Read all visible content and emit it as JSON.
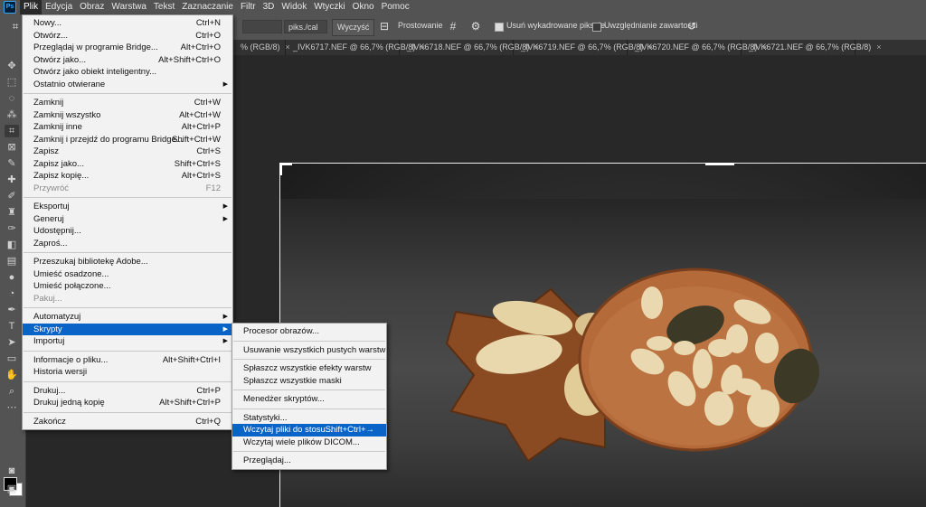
{
  "menubar": {
    "logo": "Ps",
    "items": [
      "Plik",
      "Edycja",
      "Obraz",
      "Warstwa",
      "Tekst",
      "Zaznaczanie",
      "Filtr",
      "3D",
      "Widok",
      "Wtyczki",
      "Okno",
      "Pomoc"
    ]
  },
  "options": {
    "units": "piks./cal",
    "clear": "Wyczyść",
    "straighten": "Prostowanie",
    "delete_cropped": "Usuń wykadrowane piksele",
    "content_aware": "Uwzględnianie zawartości"
  },
  "tabs": [
    "% (RGB/8)",
    "_IVK6717.NEF @ 66,7% (RGB/8)",
    "_IVK6718.NEF @ 66,7% (RGB/8)",
    "_IVK6719.NEF @ 66,7% (RGB/8)",
    "_IVK6720.NEF @ 66,7% (RGB/8)",
    "_IVK6721.NEF @ 66,7% (RGB/8)"
  ],
  "file_menu": [
    {
      "label": "Nowy...",
      "shortcut": "Ctrl+N"
    },
    {
      "label": "Otwórz...",
      "shortcut": "Ctrl+O"
    },
    {
      "label": "Przeglądaj w programie Bridge...",
      "shortcut": "Alt+Ctrl+O"
    },
    {
      "label": "Otwórz jako...",
      "shortcut": "Alt+Shift+Ctrl+O"
    },
    {
      "label": "Otwórz jako obiekt inteligentny...",
      "shortcut": ""
    },
    {
      "label": "Ostatnio otwierane",
      "shortcut": "",
      "submenu": true
    },
    {
      "sep": true
    },
    {
      "label": "Zamknij",
      "shortcut": "Ctrl+W"
    },
    {
      "label": "Zamknij wszystko",
      "shortcut": "Alt+Ctrl+W"
    },
    {
      "label": "Zamknij inne",
      "shortcut": "Alt+Ctrl+P"
    },
    {
      "label": "Zamknij i przejdź do programu Bridge...",
      "shortcut": "Shift+Ctrl+W"
    },
    {
      "label": "Zapisz",
      "shortcut": "Ctrl+S"
    },
    {
      "label": "Zapisz jako...",
      "shortcut": "Shift+Ctrl+S"
    },
    {
      "label": "Zapisz kopię...",
      "shortcut": "Alt+Ctrl+S"
    },
    {
      "label": "Przywróć",
      "shortcut": "F12",
      "disabled": true
    },
    {
      "sep": true
    },
    {
      "label": "Eksportuj",
      "shortcut": "",
      "submenu": true
    },
    {
      "label": "Generuj",
      "shortcut": "",
      "submenu": true
    },
    {
      "label": "Udostępnij...",
      "shortcut": ""
    },
    {
      "label": "Zaproś...",
      "shortcut": ""
    },
    {
      "sep": true
    },
    {
      "label": "Przeszukaj bibliotekę Adobe...",
      "shortcut": ""
    },
    {
      "label": "Umieść osadzone...",
      "shortcut": ""
    },
    {
      "label": "Umieść połączone...",
      "shortcut": ""
    },
    {
      "label": "Pakuj...",
      "shortcut": "",
      "disabled": true
    },
    {
      "sep": true
    },
    {
      "label": "Automatyzuj",
      "shortcut": "",
      "submenu": true
    },
    {
      "label": "Skrypty",
      "shortcut": "",
      "submenu": true,
      "highlight": true
    },
    {
      "label": "Importuj",
      "shortcut": "",
      "submenu": true
    },
    {
      "sep": true
    },
    {
      "label": "Informacje o pliku...",
      "shortcut": "Alt+Shift+Ctrl+I"
    },
    {
      "label": "Historia wersji",
      "shortcut": ""
    },
    {
      "sep": true
    },
    {
      "label": "Drukuj...",
      "shortcut": "Ctrl+P"
    },
    {
      "label": "Drukuj jedną kopię",
      "shortcut": "Alt+Shift+Ctrl+P"
    },
    {
      "sep": true
    },
    {
      "label": "Zakończ",
      "shortcut": "Ctrl+Q"
    }
  ],
  "scripts_menu": [
    {
      "label": "Procesor obrazów...",
      "shortcut": ""
    },
    {
      "sep": true
    },
    {
      "label": "Usuwanie wszystkich pustych warstw",
      "shortcut": ""
    },
    {
      "sep": true
    },
    {
      "label": "Spłaszcz wszystkie efekty warstw",
      "shortcut": ""
    },
    {
      "label": "Spłaszcz wszystkie maski",
      "shortcut": ""
    },
    {
      "sep": true
    },
    {
      "label": "Menedżer skryptów...",
      "shortcut": ""
    },
    {
      "sep": true
    },
    {
      "label": "Statystyki...",
      "shortcut": ""
    },
    {
      "label": "Wczytaj pliki do stosu...",
      "shortcut": "Shift+Ctrl+→",
      "highlight": true
    },
    {
      "label": "Wczytaj wiele plików DICOM...",
      "shortcut": ""
    },
    {
      "sep": true
    },
    {
      "label": "Przeglądaj...",
      "shortcut": ""
    }
  ],
  "colors": {
    "highlight": "#0a64c8",
    "menu_bg": "#f2f2f2",
    "chrome": "#535353"
  }
}
